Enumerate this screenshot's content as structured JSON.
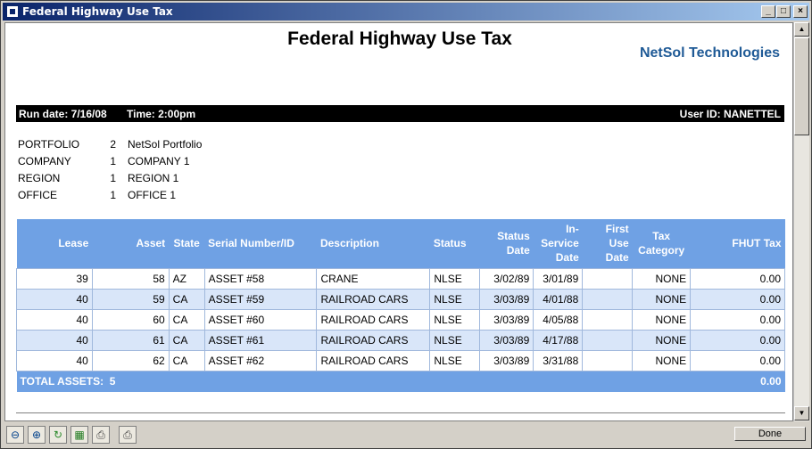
{
  "window": {
    "title": "Federal Highway Use Tax"
  },
  "report": {
    "title": "Federal Highway Use Tax",
    "brand": "NetSol Technologies",
    "run_date": "Run date: 7/16/08",
    "time": "Time: 2:00pm",
    "user_id": "User ID: NANETTEL"
  },
  "filters": [
    {
      "label": "PORTFOLIO",
      "num": "2",
      "value": "NetSol Portfolio"
    },
    {
      "label": "COMPANY",
      "num": "1",
      "value": "COMPANY 1"
    },
    {
      "label": "REGION",
      "num": "1",
      "value": "REGION 1"
    },
    {
      "label": "OFFICE",
      "num": "1",
      "value": "OFFICE 1"
    }
  ],
  "table": {
    "headers": {
      "lease": "Lease",
      "asset": "Asset",
      "state": "State",
      "serial": "Serial Number/ID",
      "description": "Description",
      "status": "Status",
      "status_date_1": "Status",
      "status_date_2": "Date",
      "in_service_1": "In-",
      "in_service_2": "Service",
      "in_service_3": "Date",
      "first_use_1": "First",
      "first_use_2": "Use",
      "first_use_3": "Date",
      "tax_cat_1": "Tax",
      "tax_cat_2": "Category",
      "fhut_tax": "FHUT Tax"
    },
    "rows": [
      {
        "lease": "39",
        "asset": "58",
        "state": "AZ",
        "serial": "ASSET #58",
        "description": "CRANE",
        "status": "NLSE",
        "status_date": "3/02/89",
        "in_service": "3/01/89",
        "first_use": "",
        "tax_category": "NONE",
        "fhut_tax": "0.00"
      },
      {
        "lease": "40",
        "asset": "59",
        "state": "CA",
        "serial": "ASSET #59",
        "description": "RAILROAD CARS",
        "status": "NLSE",
        "status_date": "3/03/89",
        "in_service": "4/01/88",
        "first_use": "",
        "tax_category": "NONE",
        "fhut_tax": "0.00"
      },
      {
        "lease": "40",
        "asset": "60",
        "state": "CA",
        "serial": "ASSET #60",
        "description": "RAILROAD CARS",
        "status": "NLSE",
        "status_date": "3/03/89",
        "in_service": "4/05/88",
        "first_use": "",
        "tax_category": "NONE",
        "fhut_tax": "0.00"
      },
      {
        "lease": "40",
        "asset": "61",
        "state": "CA",
        "serial": "ASSET #61",
        "description": "RAILROAD CARS",
        "status": "NLSE",
        "status_date": "3/03/89",
        "in_service": "4/17/88",
        "first_use": "",
        "tax_category": "NONE",
        "fhut_tax": "0.00"
      },
      {
        "lease": "40",
        "asset": "62",
        "state": "CA",
        "serial": "ASSET #62",
        "description": "RAILROAD CARS",
        "status": "NLSE",
        "status_date": "3/03/89",
        "in_service": "3/31/88",
        "first_use": "",
        "tax_category": "NONE",
        "fhut_tax": "0.00"
      }
    ],
    "total_label": "TOTAL ASSETS:",
    "total_count": "5",
    "total_fhut": "0.00"
  },
  "toolbar": {
    "icons": [
      "zoom-out-icon",
      "zoom-in-icon",
      "refresh-icon",
      "excel-export-icon",
      "print-icon",
      "printer-icon"
    ],
    "done_label": "Done"
  },
  "colors": {
    "header_blue": "#6fa1e4",
    "row_alt": "#d9e6f9",
    "brand": "#1f5a96",
    "title_bar": "#0a246a"
  }
}
